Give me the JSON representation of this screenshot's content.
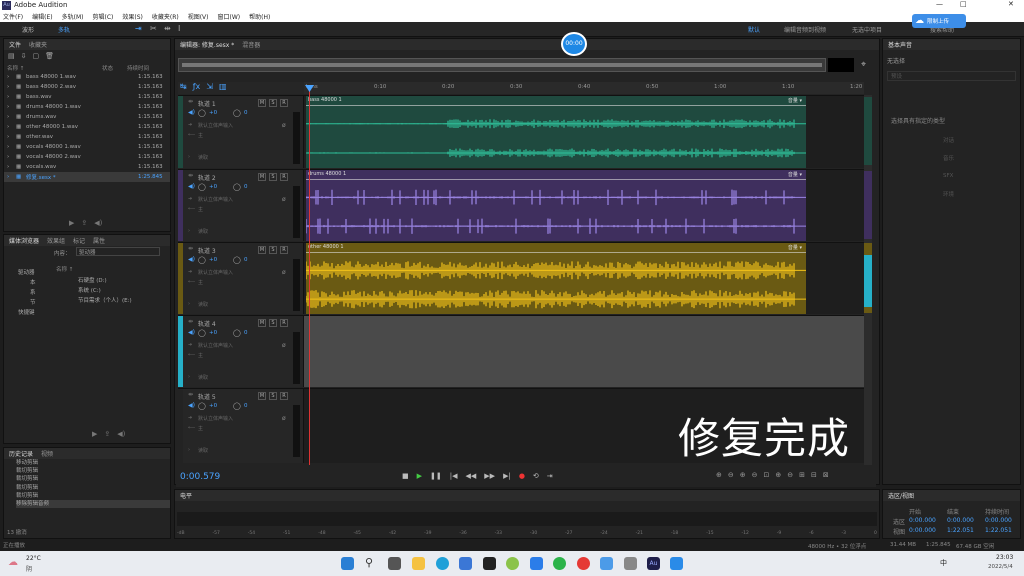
{
  "app": {
    "title": "Adobe Audition",
    "win_min": "—",
    "win_max": "□",
    "win_close": "✕"
  },
  "menus": [
    "文件(F)",
    "编辑(E)",
    "多轨(M)",
    "剪辑(C)",
    "效果(S)",
    "收藏夹(R)",
    "视图(V)",
    "窗口(W)",
    "帮助(H)"
  ],
  "toolbar": {
    "waveform": "波形",
    "multitrack": "多轨",
    "default": "默认",
    "edit_audio": "编辑音频到视频",
    "no_favorites": "无选中项目",
    "search": "搜索帮助"
  },
  "upload_badge": "限制上传",
  "files_panel": {
    "tabs": [
      "文件",
      "收藏夹"
    ],
    "col_name": "名称 ↑",
    "col_status": "状态",
    "col_duration": "持续时间",
    "files": [
      {
        "name": "bass 48000 1.wav",
        "duration": "1:15.163"
      },
      {
        "name": "bass 48000 2.wav",
        "duration": "1:15.163"
      },
      {
        "name": "bass.wav",
        "duration": "1:15.163"
      },
      {
        "name": "drums 48000 1.wav",
        "duration": "1:15.163"
      },
      {
        "name": "drums.wav",
        "duration": "1:15.163"
      },
      {
        "name": "other 48000 1.wav",
        "duration": "1:15.163"
      },
      {
        "name": "other.wav",
        "duration": "1:15.163"
      },
      {
        "name": "vocals 48000 1.wav",
        "duration": "1:15.163"
      },
      {
        "name": "vocals 48000 2.wav",
        "duration": "1:15.163"
      },
      {
        "name": "vocals.wav",
        "duration": "1:15.163"
      },
      {
        "name": "修复.sesx *",
        "duration": "1:25.845"
      }
    ]
  },
  "media_panel": {
    "tabs": [
      "媒体浏览器",
      "效果组",
      "标记",
      "属性"
    ],
    "content_label": "内容：",
    "content_value": "驱动器",
    "col_name": "名称 ↑",
    "drive_tree": [
      "驱动器",
      "本",
      "系",
      "节",
      "快捷键"
    ],
    "drives": [
      "石硬盘 (D:)",
      "系统 (C:)",
      "节目需求（个人）(E:)"
    ]
  },
  "history_panel": {
    "tabs": [
      "历史记录",
      "视频"
    ],
    "items": [
      "移动剪辑",
      "裁切剪辑",
      "裁切剪辑",
      "裁切剪辑",
      "裁切剪辑",
      "移除剪辑音频"
    ],
    "count": "13 撤消"
  },
  "status_left": "正在播放",
  "editor": {
    "tabs": [
      "编辑器: 修复.sesx *",
      "混音器"
    ],
    "timecode_badge": "00:00"
  },
  "ruler": {
    "labels": [
      "hms",
      "0:10",
      "0:20",
      "0:30",
      "0:40",
      "0:50",
      "1:00",
      "1:10",
      "1:20"
    ]
  },
  "tracks": [
    {
      "name": "轨道 1",
      "vol": "+0",
      "pan": "0",
      "input": "默认立体声输入",
      "output": "主",
      "mode": "读取",
      "clip": "bass 48000 1",
      "tag": "音量 ▾",
      "color": "#1f4a3f",
      "wave": "#2fbf99"
    },
    {
      "name": "轨道 2",
      "vol": "+0",
      "pan": "0",
      "input": "默认立体声输入",
      "output": "主",
      "mode": "读取",
      "clip": "drums 48000 1",
      "tag": "音量 ▾",
      "color": "#3f2f5e",
      "wave": "#9c86e6"
    },
    {
      "name": "轨道 3",
      "vol": "+0",
      "pan": "0",
      "input": "默认立体声输入",
      "output": "主",
      "mode": "读取",
      "clip": "other 48000 1",
      "tag": "音量 ▾",
      "color": "#6a5a13",
      "wave": "#f2c21a"
    },
    {
      "name": "轨道 4",
      "vol": "+0",
      "pan": "0",
      "input": "默认立体声输入",
      "output": "主",
      "mode": "读取",
      "clip": "",
      "tag": "",
      "color": "#4a4a4a",
      "wave": ""
    },
    {
      "name": "轨道 5",
      "vol": "+0",
      "pan": "0",
      "input": "默认立体声输入",
      "output": "主",
      "mode": "读取",
      "clip": "",
      "tag": "",
      "color": "#232323",
      "wave": ""
    }
  ],
  "transport": {
    "time": "0:00.579"
  },
  "levels": {
    "title": "电平",
    "scale": [
      "-dB",
      "-57",
      "-54",
      "-51",
      "-48",
      "-45",
      "-42",
      "-39",
      "-36",
      "-33",
      "-30",
      "-27",
      "-24",
      "-21",
      "-18",
      "-15",
      "-12",
      "-9",
      "-6",
      "-3",
      "0"
    ]
  },
  "right_panel": {
    "title": "基本声音",
    "no_selection": "无选择",
    "preset": "预设",
    "hint": "选择具有指定的类型",
    "buttons": [
      "对话",
      "音乐",
      "SFX",
      "环境"
    ]
  },
  "selection_panel": {
    "title": "选区/视图",
    "start": "开始",
    "end": "结束",
    "duration": "持续时间",
    "sel_label": "选区",
    "view_label": "视图",
    "sel": [
      "0:00.000",
      "0:00.000",
      "0:00.000"
    ],
    "view": [
      "0:00.000",
      "1:22.051",
      "1:22.051"
    ]
  },
  "statusbar": {
    "rate": "48000 Hz • 32 位浮点",
    "size": "31.44 MB",
    "dur": "1:25.845",
    "free": "67.48 GB 空闲"
  },
  "caption": "修复完成",
  "taskbar": {
    "weather_temp": "22°C",
    "weather_text": "阴",
    "ime": "中",
    "clock_time": "23:03",
    "clock_date": "2022/5/4"
  }
}
